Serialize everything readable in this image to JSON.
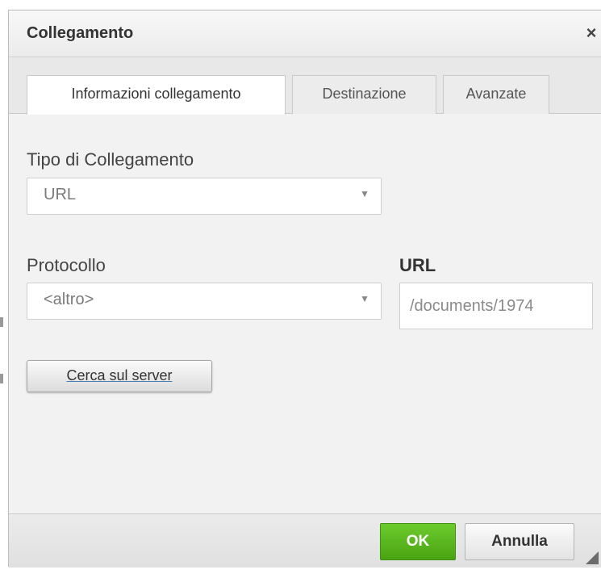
{
  "dialog": {
    "title": "Collegamento",
    "close_symbol": "×"
  },
  "tabs": [
    {
      "label": "Informazioni collegamento",
      "active": true
    },
    {
      "label": "Destinazione",
      "active": false
    },
    {
      "label": "Avanzate",
      "active": false
    }
  ],
  "link_type": {
    "label": "Tipo di Collegamento",
    "selected": "URL",
    "arrow": "▼"
  },
  "protocol": {
    "label": "Protocollo",
    "selected": "<altro>",
    "arrow": "▼"
  },
  "url": {
    "label": "URL",
    "value": "/documents/1974"
  },
  "browse_server": {
    "label": "Cerca sul server"
  },
  "footer": {
    "ok_label": "OK",
    "cancel_label": "Annulla"
  },
  "colors": {
    "ok_green": "#5bb81d",
    "dialog_bg": "#f2f2f2",
    "link_underline": "#4a7fb5"
  },
  "icons": {
    "close": "close-icon",
    "dropdown": "chevron-down-icon",
    "resize": "resize-grip-icon"
  }
}
